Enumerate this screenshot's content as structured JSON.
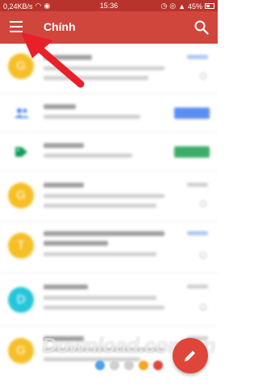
{
  "status_bar": {
    "network_speed": "0,24KB/s",
    "time": "15:36",
    "battery": "45%"
  },
  "app_bar": {
    "title": "Chính",
    "menu_icon": "menu-icon",
    "search_icon": "search-icon"
  },
  "list": {
    "rows": [
      {
        "type": "message",
        "avatar": "G",
        "avatar_color": "#f6bf26"
      },
      {
        "type": "category",
        "icon": "people-icon",
        "icon_color": "#4285f4",
        "chip_color": "#4285f4"
      },
      {
        "type": "category",
        "icon": "tag-icon",
        "icon_color": "#0f9d58",
        "chip_color": "#0f9d58"
      },
      {
        "type": "message",
        "avatar": "G",
        "avatar_color": "#f6bf26"
      },
      {
        "type": "message",
        "avatar": "T",
        "avatar_color": "#f6bf26"
      },
      {
        "type": "message",
        "avatar": "D",
        "avatar_color": "#26c6da"
      },
      {
        "type": "message",
        "avatar": "G",
        "avatar_color": "#f6bf26"
      }
    ]
  },
  "watermark": "Download.com.vn",
  "colors": {
    "status_bar": "#b8332c",
    "app_bar": "#d0463d",
    "arrow": "#e8202a",
    "fab": "#e0453a"
  }
}
